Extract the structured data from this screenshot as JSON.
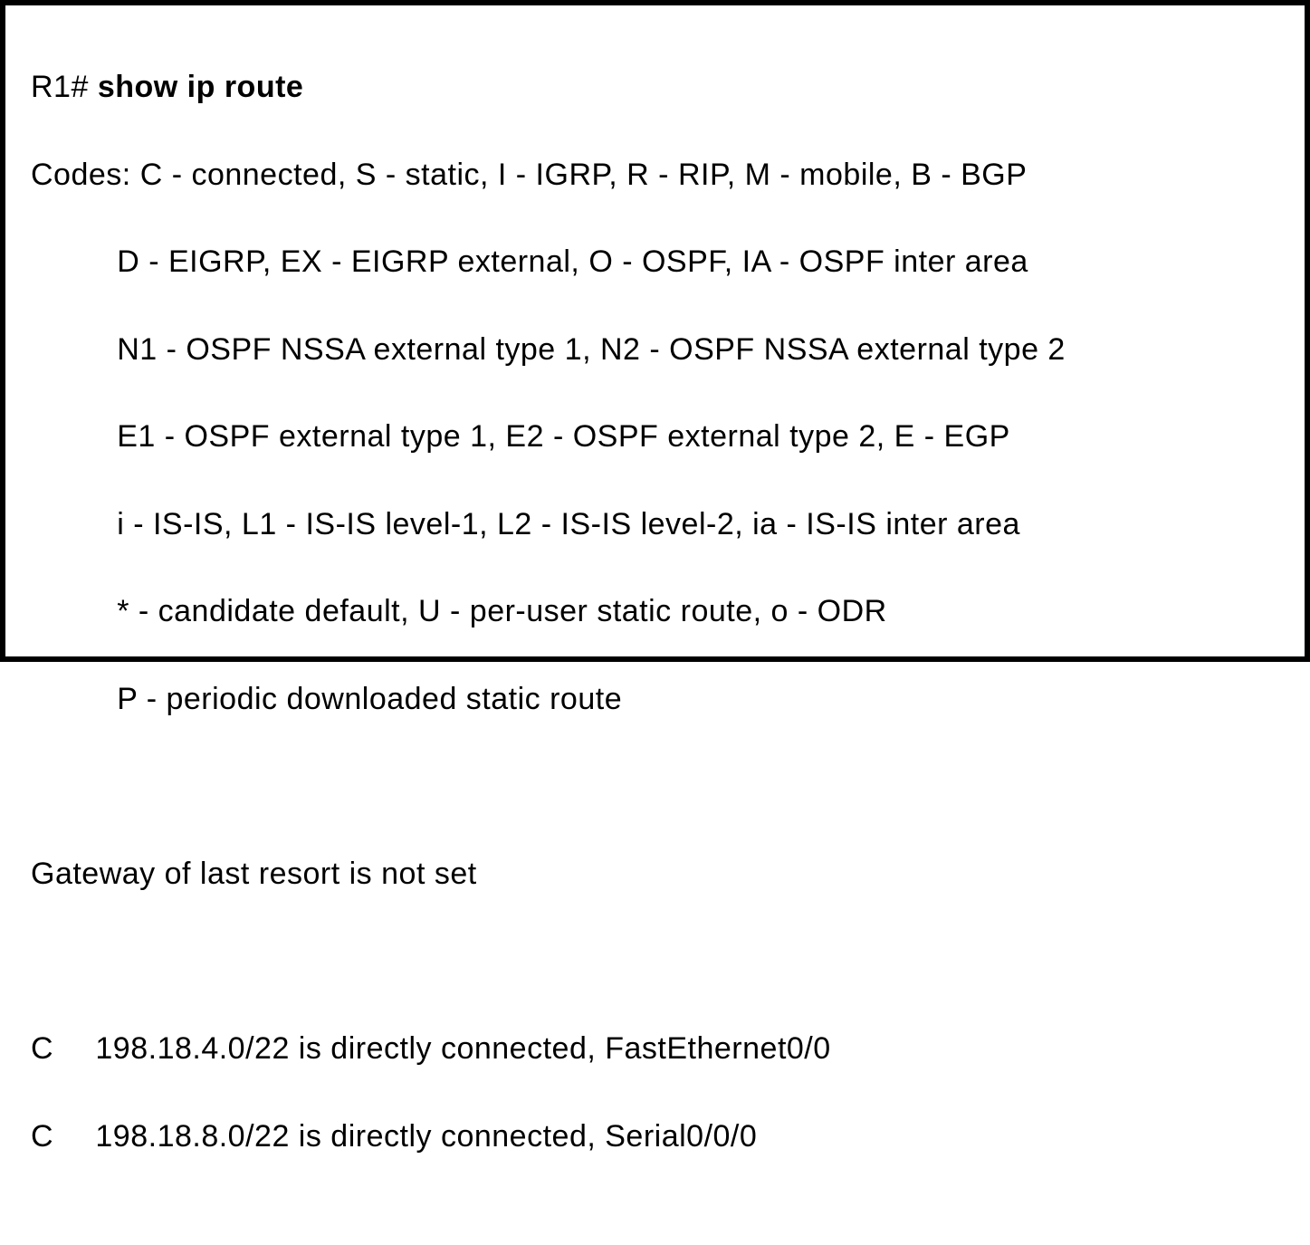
{
  "terminal": {
    "prompt": "R1# ",
    "command": "show ip route",
    "codes_prefix": "Codes: ",
    "codes_first": "C - connected, S - static, I - IGRP, R - RIP, M - mobile, B - BGP",
    "codes_lines": [
      "D - EIGRP, EX - EIGRP external, O - OSPF, IA - OSPF inter area",
      "N1 - OSPF NSSA external type 1, N2 - OSPF NSSA external type 2",
      "E1 - OSPF external type 1, E2 - OSPF external type 2, E - EGP",
      "i - IS-IS, L1 - IS-IS level-1, L2 - IS-IS level-2, ia - IS-IS inter area",
      "* - candidate default, U - per-user static route, o - ODR",
      "P - periodic downloaded static route"
    ],
    "gateway": "Gateway of last resort is not set",
    "routes": [
      {
        "code": "C",
        "text": "198.18.4.0/22 is directly connected, FastEthernet0/0"
      },
      {
        "code": "C",
        "text": "198.18.8.0/22 is directly connected, Serial0/0/0"
      }
    ]
  }
}
